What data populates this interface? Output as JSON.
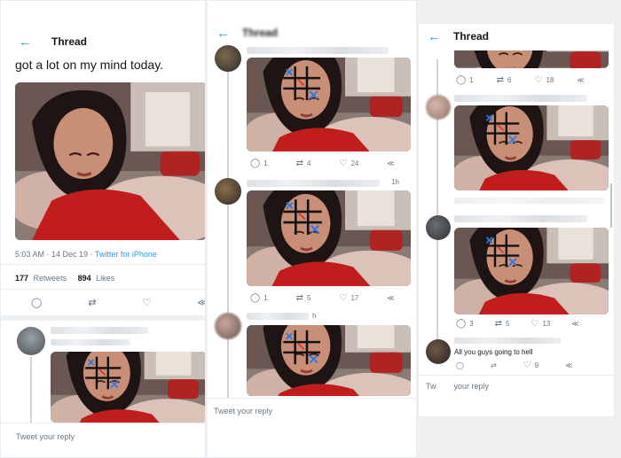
{
  "p1": {
    "back_icon": "arrow-left-icon",
    "title": "Thread",
    "tweet_text": "got a lot on my mind today.",
    "time": "5:03 AM · 14 Dec 19 · ",
    "client": "Twitter for iPhone",
    "retweets_count": "177",
    "retweets_label": "Retweets",
    "likes_count": "894",
    "likes_label": "Likes",
    "reply_placeholder": "Tweet your reply"
  },
  "p2": {
    "back_icon": "arrow-left-icon",
    "title": "Thread",
    "posts": [
      {
        "time": "",
        "replies": "1",
        "retweets": "4",
        "likes": "24"
      },
      {
        "time": "1h",
        "replies": "1",
        "retweets": "5",
        "likes": "17"
      },
      {
        "time": "h"
      }
    ],
    "reply_placeholder": "Tweet your reply"
  },
  "p3": {
    "back_icon": "arrow-left-icon",
    "title": "Thread",
    "top_actions": {
      "replies": "1",
      "retweets": "6",
      "likes": "18"
    },
    "mid_actions": {
      "replies": "3",
      "retweets": "5",
      "likes": "13"
    },
    "last_reply_text": "All you guys going to hell",
    "last_actions": {
      "likes": "9"
    },
    "reply_placeholder": "Tw        your reply"
  },
  "colors": {
    "accent": "#1da1f2",
    "muted": "#657786",
    "border": "#e6ecf0"
  }
}
